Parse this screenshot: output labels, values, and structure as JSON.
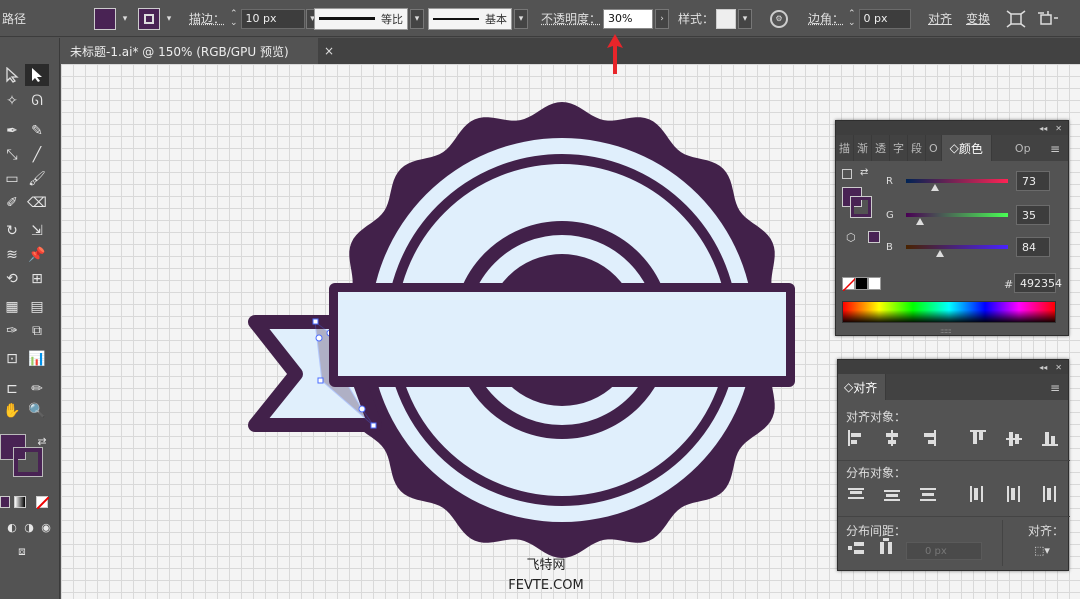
{
  "topbar": {
    "object_type": "路径",
    "stroke_label": "描边：",
    "stroke_width": "10 px",
    "stroke_profile": "等比",
    "brush_def": "基本",
    "opacity_label": "不透明度：",
    "opacity_value": "30%",
    "style_label": "样式：",
    "corner_label": "边角：",
    "corner_value": "0 px",
    "align_label": "对齐",
    "transform_label": "变换",
    "fill_color": "#492354"
  },
  "document": {
    "tab_title": "未标题-1.ai* @ 150% (RGB/GPU 预览)",
    "close": "×"
  },
  "color_panel": {
    "tabs": [
      "描",
      "渐",
      "透",
      "字",
      "段",
      "O"
    ],
    "active_tab": "颜色",
    "extra_tab": "Op",
    "r_label": "R",
    "g_label": "G",
    "b_label": "B",
    "r_value": "73",
    "g_value": "35",
    "b_value": "84",
    "r": 73,
    "g": 35,
    "b": 84,
    "hex_label": "#",
    "hex_value": "492354"
  },
  "align_panel": {
    "title": "对齐",
    "align_objects": "对齐对象：",
    "distribute_objects": "分布对象：",
    "distribute_spacing": "分布间距：",
    "align_to": "对齐：",
    "spacing_value": "0 px"
  },
  "artwork": {
    "dark": "#42214a",
    "light": "#e0effc"
  },
  "watermark": {
    "line1": "飞特网",
    "line2": "FEVTE.COM"
  }
}
